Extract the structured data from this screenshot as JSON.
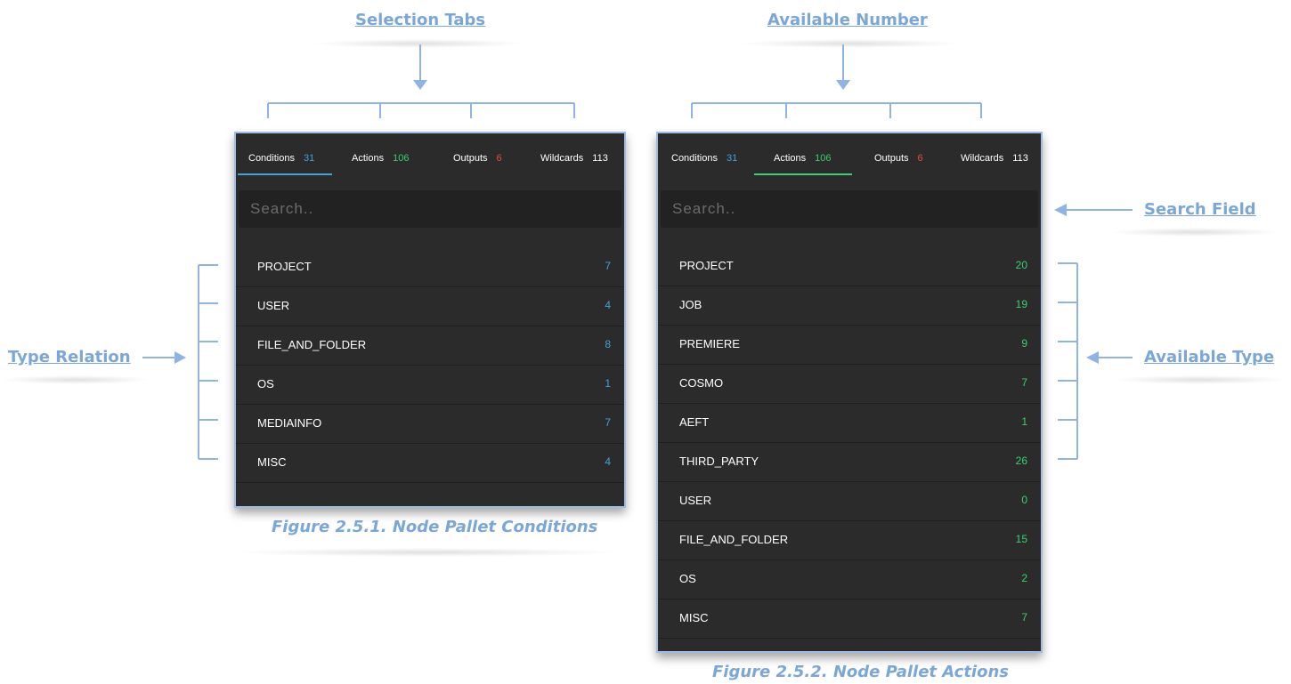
{
  "annotations": {
    "selection_tabs": "Selection Tabs",
    "available_number": "Available Number",
    "search_field": "Search Field",
    "type_relation": "Type Relation",
    "available_type": "Available Type"
  },
  "colors": {
    "conditions": "#43a3d8",
    "actions": "#3ccf6f",
    "outputs": "#e0503a",
    "wildcards": "#ffffff",
    "annotation": "#7aa6d8"
  },
  "panel1": {
    "caption": "Figure 2.5.1. Node Pallet Conditions",
    "tabs": [
      {
        "label": "Conditions",
        "count": "31"
      },
      {
        "label": "Actions",
        "count": "106"
      },
      {
        "label": "Outputs",
        "count": "6"
      },
      {
        "label": "Wildcards",
        "count": "113"
      }
    ],
    "active_tab": "Conditions",
    "search_placeholder": "Search..",
    "items": [
      {
        "label": "PROJECT",
        "count": "7"
      },
      {
        "label": "USER",
        "count": "4"
      },
      {
        "label": "FILE_AND_FOLDER",
        "count": "8"
      },
      {
        "label": "OS",
        "count": "1"
      },
      {
        "label": "MEDIAINFO",
        "count": "7"
      },
      {
        "label": "MISC",
        "count": "4"
      }
    ]
  },
  "panel2": {
    "caption": "Figure 2.5.2. Node Pallet Actions",
    "tabs": [
      {
        "label": "Conditions",
        "count": "31"
      },
      {
        "label": "Actions",
        "count": "106"
      },
      {
        "label": "Outputs",
        "count": "6"
      },
      {
        "label": "Wildcards",
        "count": "113"
      }
    ],
    "active_tab": "Actions",
    "search_placeholder": "Search..",
    "items": [
      {
        "label": "PROJECT",
        "count": "20"
      },
      {
        "label": "JOB",
        "count": "19"
      },
      {
        "label": "PREMIERE",
        "count": "9"
      },
      {
        "label": "COSMO",
        "count": "7"
      },
      {
        "label": "AEFT",
        "count": "1"
      },
      {
        "label": "THIRD_PARTY",
        "count": "26"
      },
      {
        "label": "USER",
        "count": "0"
      },
      {
        "label": "FILE_AND_FOLDER",
        "count": "15"
      },
      {
        "label": "OS",
        "count": "2"
      },
      {
        "label": "MISC",
        "count": "7"
      }
    ]
  }
}
